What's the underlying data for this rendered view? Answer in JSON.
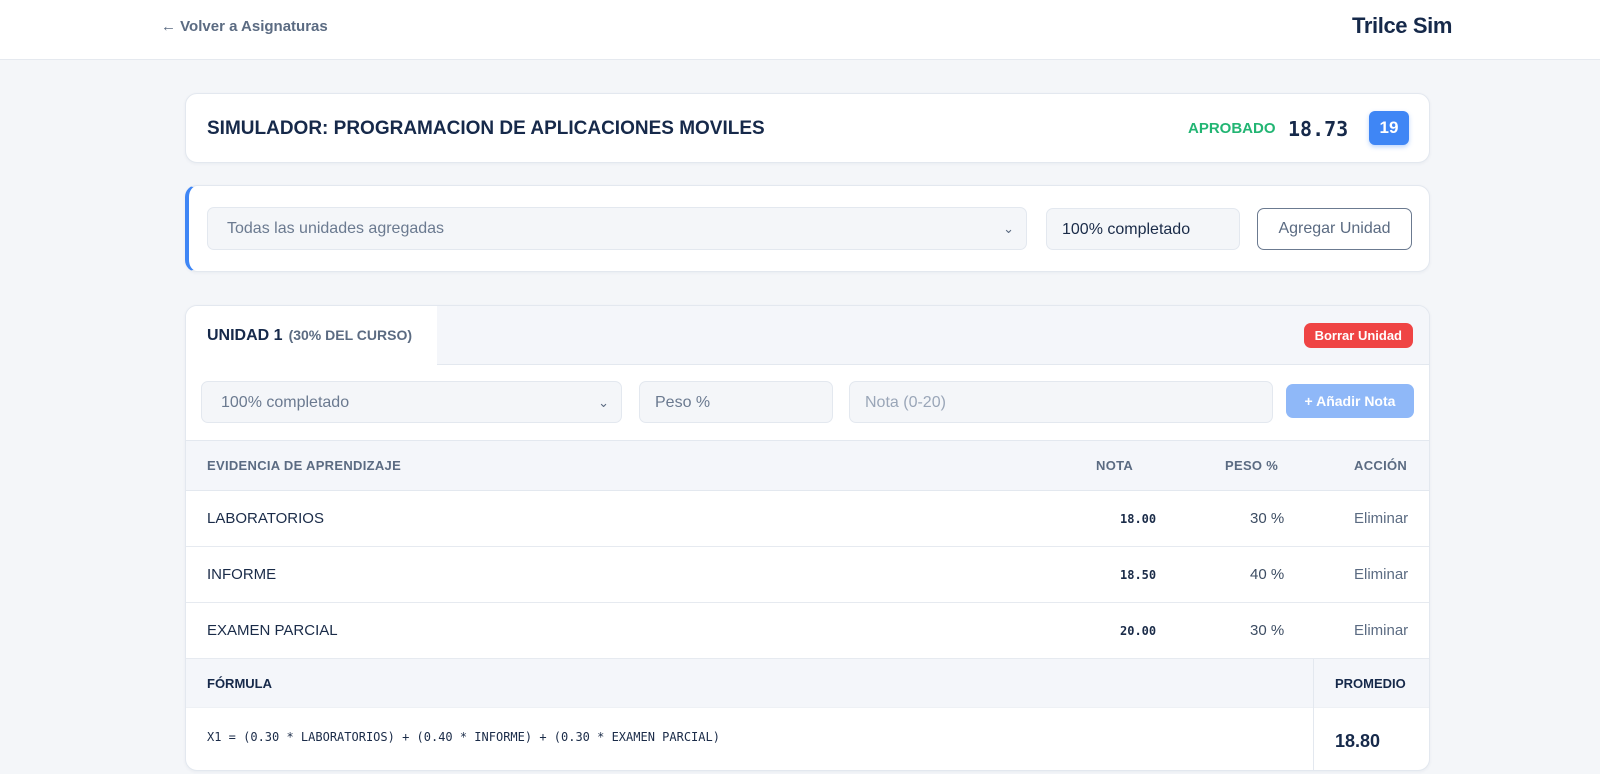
{
  "nav": {
    "back_label": "← Volver a Asignaturas",
    "brand": "Trilce Sim"
  },
  "summary": {
    "title": "SIMULADOR: PROGRAMACION DE APLICACIONES MOVILES",
    "status": "APROBADO",
    "score": "18.73",
    "rounded": "19",
    "status_color": "#22b573",
    "accent_color": "#3f86f5"
  },
  "controls": {
    "unit_select": "Todas las unidades agregadas",
    "progress": "100% completado",
    "add_unit_label": "Agregar Unidad"
  },
  "unit": {
    "name": "UNIDAD 1",
    "weight": "(30% DEL CURSO)",
    "delete_label": "Borrar Unidad",
    "evidence_select": "100% completado",
    "peso_placeholder": "Peso %",
    "nota_placeholder": "Nota (0-20)",
    "add_note_label": "+ Añadir Nota",
    "table": {
      "headers": [
        "EVIDENCIA DE APRENDIZAJE",
        "NOTA",
        "PESO %",
        "ACCIÓN"
      ],
      "rows": [
        {
          "name": "LABORATORIOS",
          "nota": "18.00",
          "peso": "30 %",
          "action": "Eliminar"
        },
        {
          "name": "INFORME",
          "nota": "18.50",
          "peso": "40 %",
          "action": "Eliminar"
        },
        {
          "name": "EXAMEN PARCIAL",
          "nota": "20.00",
          "peso": "30 %",
          "action": "Eliminar"
        }
      ]
    },
    "formula_label": "FÓRMULA",
    "promedio_label": "PROMEDIO",
    "formula": "X1 = (0.30 * LABORATORIOS) + (0.40 * INFORME) + (0.30 * EXAMEN PARCIAL)",
    "promedio": "18.80"
  }
}
